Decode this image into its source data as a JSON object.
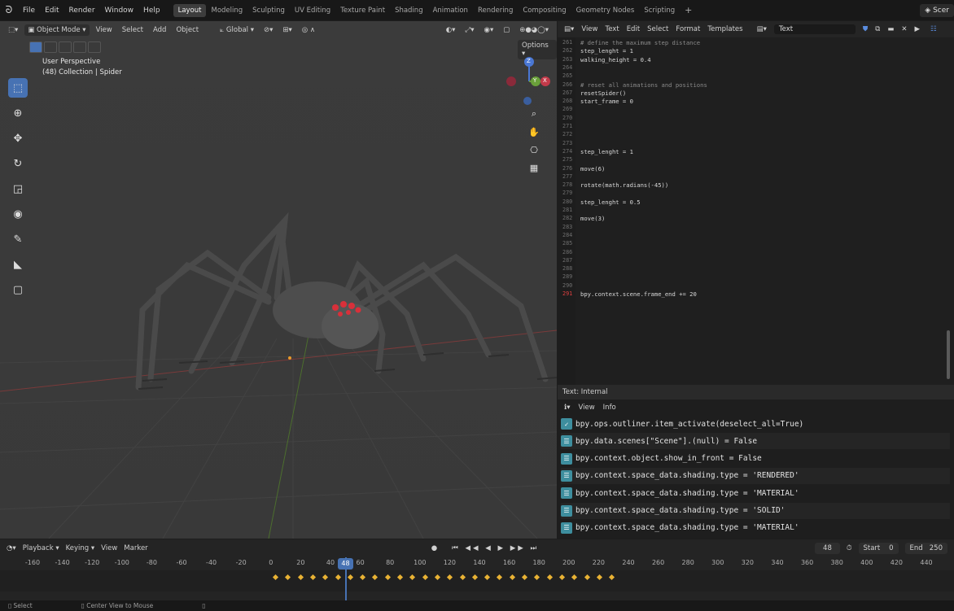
{
  "menu": {
    "items": [
      "File",
      "Edit",
      "Render",
      "Window",
      "Help"
    ],
    "workspaces": [
      "Layout",
      "Modeling",
      "Sculpting",
      "UV Editing",
      "Texture Paint",
      "Shading",
      "Animation",
      "Rendering",
      "Compositing",
      "Geometry Nodes",
      "Scripting"
    ],
    "active_workspace": "Layout",
    "scene_label": "Scer"
  },
  "viewport": {
    "mode": "Object Mode",
    "menus": [
      "View",
      "Select",
      "Add",
      "Object"
    ],
    "orientation": "Global",
    "options_label": "Options",
    "perspective": "User Perspective",
    "collection": "(48) Collection | Spider",
    "gizmo_labels": {
      "z": "Z",
      "y": "Y",
      "x": "X"
    }
  },
  "text_editor": {
    "menus": [
      "View",
      "Text",
      "Edit",
      "Select",
      "Format",
      "Templates"
    ],
    "file_name": "Text",
    "footer": "Text: Internal",
    "lines": [
      {
        "n": "261",
        "text": "# define the maximum step distance",
        "kind": "comment"
      },
      {
        "n": "262",
        "text": "step_lenght = 1",
        "kind": "code"
      },
      {
        "n": "263",
        "text": "walking_height = 0.4",
        "kind": "code"
      },
      {
        "n": "264",
        "text": "",
        "kind": "code"
      },
      {
        "n": "265",
        "text": "",
        "kind": "code"
      },
      {
        "n": "266",
        "text": "# reset all animations and positions",
        "kind": "comment"
      },
      {
        "n": "267",
        "text": "resetSpider()",
        "kind": "code"
      },
      {
        "n": "268",
        "text": "start_frame = 0",
        "kind": "code"
      },
      {
        "n": "269",
        "text": "",
        "kind": "code"
      },
      {
        "n": "270",
        "text": "",
        "kind": "code"
      },
      {
        "n": "271",
        "text": "",
        "kind": "code"
      },
      {
        "n": "272",
        "text": "",
        "kind": "code"
      },
      {
        "n": "273",
        "text": "",
        "kind": "code"
      },
      {
        "n": "274",
        "text": "step_lenght = 1",
        "kind": "code"
      },
      {
        "n": "275",
        "text": "",
        "kind": "code"
      },
      {
        "n": "276",
        "text": "move(6)",
        "kind": "code"
      },
      {
        "n": "277",
        "text": "",
        "kind": "code"
      },
      {
        "n": "278",
        "text": "rotate(math.radians(-45))",
        "kind": "code"
      },
      {
        "n": "279",
        "text": "",
        "kind": "code"
      },
      {
        "n": "280",
        "text": "step_lenght = 0.5",
        "kind": "code"
      },
      {
        "n": "281",
        "text": "",
        "kind": "code"
      },
      {
        "n": "282",
        "text": "move(3)",
        "kind": "code"
      },
      {
        "n": "283",
        "text": "",
        "kind": "code"
      },
      {
        "n": "284",
        "text": "",
        "kind": "code"
      },
      {
        "n": "285",
        "text": "",
        "kind": "code"
      },
      {
        "n": "286",
        "text": "",
        "kind": "code"
      },
      {
        "n": "287",
        "text": "",
        "kind": "code"
      },
      {
        "n": "288",
        "text": "",
        "kind": "code"
      },
      {
        "n": "289",
        "text": "",
        "kind": "code"
      },
      {
        "n": "290",
        "text": "",
        "kind": "code"
      },
      {
        "n": "291",
        "text": "bpy.context.scene.frame_end += 20",
        "kind": "error"
      }
    ]
  },
  "info": {
    "menus": [
      "View",
      "Info"
    ],
    "logs": [
      "bpy.ops.outliner.item_activate(deselect_all=True)",
      "bpy.data.scenes[\"Scene\"].(null) = False",
      "bpy.context.object.show_in_front = False",
      "bpy.context.space_data.shading.type = 'RENDERED'",
      "bpy.context.space_data.shading.type = 'MATERIAL'",
      "bpy.context.space_data.shading.type = 'SOLID'",
      "bpy.context.space_data.shading.type = 'MATERIAL'"
    ]
  },
  "timeline": {
    "menus": [
      "Playback",
      "Keying",
      "View",
      "Marker"
    ],
    "current_frame": "48",
    "start_label": "Start",
    "start": "0",
    "end_label": "End",
    "end": "250",
    "ticks": [
      "-160",
      "-140",
      "-120",
      "-100",
      "-80",
      "-60",
      "-40",
      "-20",
      "0",
      "20",
      "40",
      "60",
      "80",
      "100",
      "120",
      "140",
      "160",
      "180",
      "200",
      "220",
      "240",
      "260",
      "280",
      "300",
      "320",
      "340",
      "360",
      "380",
      "400",
      "420",
      "440"
    ]
  },
  "status": {
    "select": "Select",
    "center": "Center View to Mouse"
  }
}
